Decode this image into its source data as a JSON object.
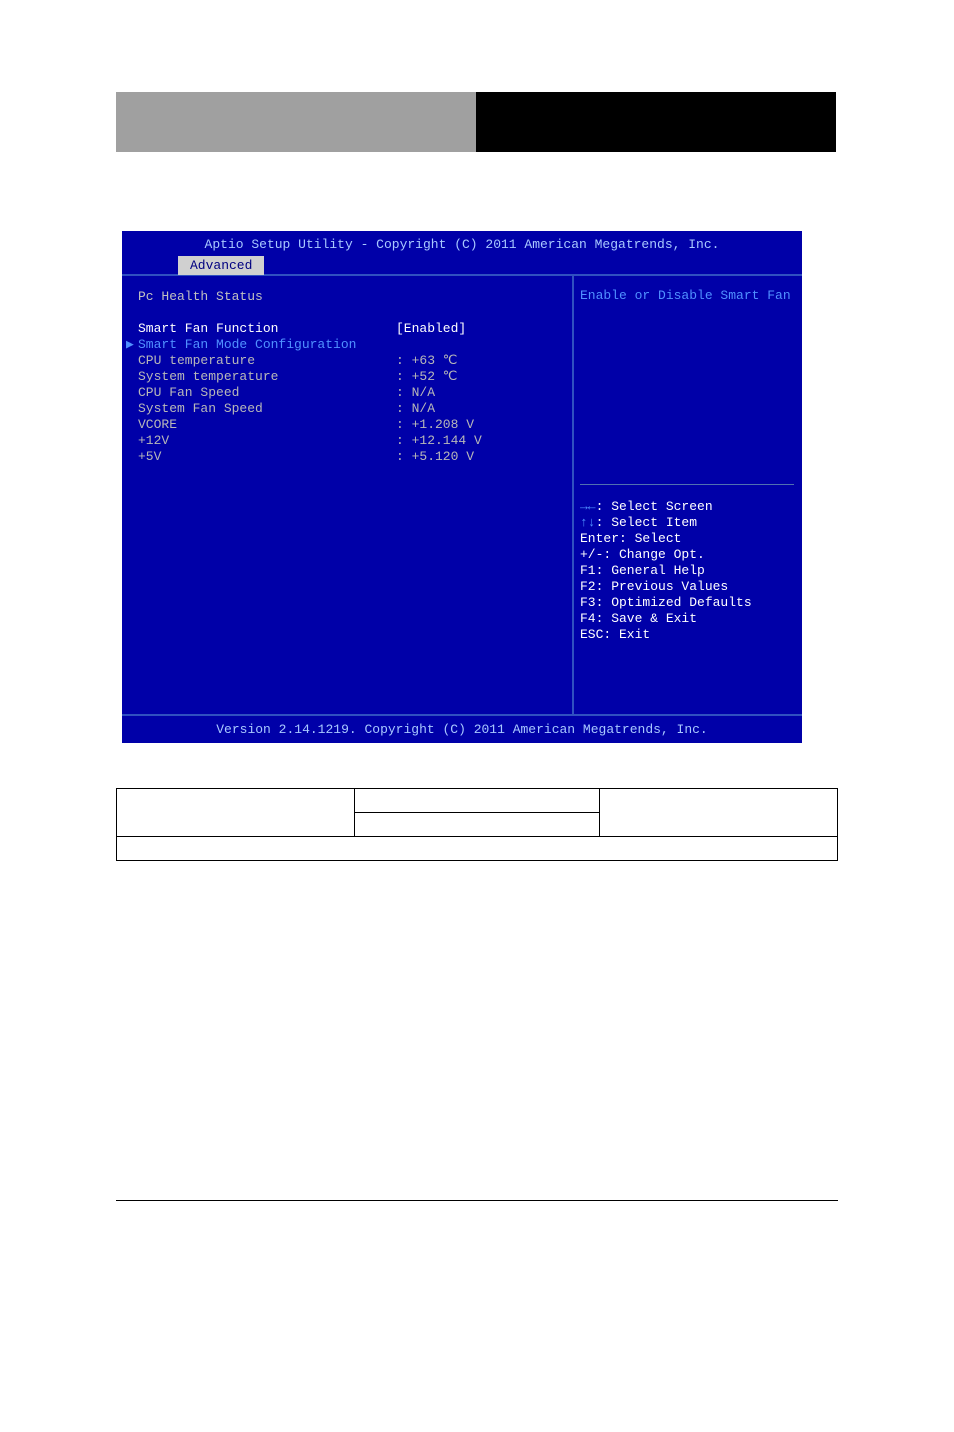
{
  "header": {
    "left_label": "",
    "right_label": ""
  },
  "bios": {
    "title": "Aptio Setup Utility - Copyright (C) 2011 American Megatrends, Inc.",
    "tab": "Advanced",
    "section_title": "Pc Health Status",
    "rows": [
      {
        "label": "Smart Fan Function",
        "value": "[Enabled]",
        "selected": true
      },
      {
        "label": "Smart Fan Mode Configuration",
        "value": "",
        "submenu": true
      },
      {
        "label": "CPU temperature",
        "value": ": +63 ℃"
      },
      {
        "label": "System temperature",
        "value": ": +52 ℃"
      },
      {
        "label": "CPU Fan Speed",
        "value": ": N/A"
      },
      {
        "label": "System Fan Speed",
        "value": ": N/A"
      },
      {
        "label": "VCORE",
        "value": ": +1.208 V"
      },
      {
        "label": "+12V",
        "value": ": +12.144 V"
      },
      {
        "label": "+5V",
        "value": ": +5.120 V"
      }
    ],
    "help_top": "Enable or Disable Smart Fan",
    "help_lines": [
      {
        "sym": "→←",
        "text": ": Select Screen"
      },
      {
        "sym": "↑↓",
        "text": ": Select Item"
      },
      {
        "sym": "",
        "text": "Enter: Select"
      },
      {
        "sym": "",
        "text": "+/-: Change Opt."
      },
      {
        "sym": "",
        "text": "F1: General Help"
      },
      {
        "sym": "",
        "text": "F2: Previous Values"
      },
      {
        "sym": "",
        "text": "F3: Optimized Defaults"
      },
      {
        "sym": "",
        "text": "F4: Save & Exit"
      },
      {
        "sym": "",
        "text": "ESC: Exit"
      }
    ],
    "footer": "Version 2.14.1219. Copyright (C) 2011 American Megatrends, Inc."
  },
  "table": {
    "r1c1": "",
    "r1c2": "",
    "r1c3": "",
    "r2c2": "",
    "r3": ""
  },
  "chart_data": {
    "type": "table",
    "title": "Pc Health Status (BIOS hardware monitor readings)",
    "rows": [
      {
        "item": "Smart Fan Function",
        "value": "Enabled"
      },
      {
        "item": "CPU temperature",
        "value": 63,
        "unit": "°C"
      },
      {
        "item": "System temperature",
        "value": 52,
        "unit": "°C"
      },
      {
        "item": "CPU Fan Speed",
        "value": null,
        "display": "N/A"
      },
      {
        "item": "System Fan Speed",
        "value": null,
        "display": "N/A"
      },
      {
        "item": "VCORE",
        "value": 1.208,
        "unit": "V"
      },
      {
        "item": "+12V",
        "value": 12.144,
        "unit": "V"
      },
      {
        "item": "+5V",
        "value": 5.12,
        "unit": "V"
      }
    ]
  }
}
